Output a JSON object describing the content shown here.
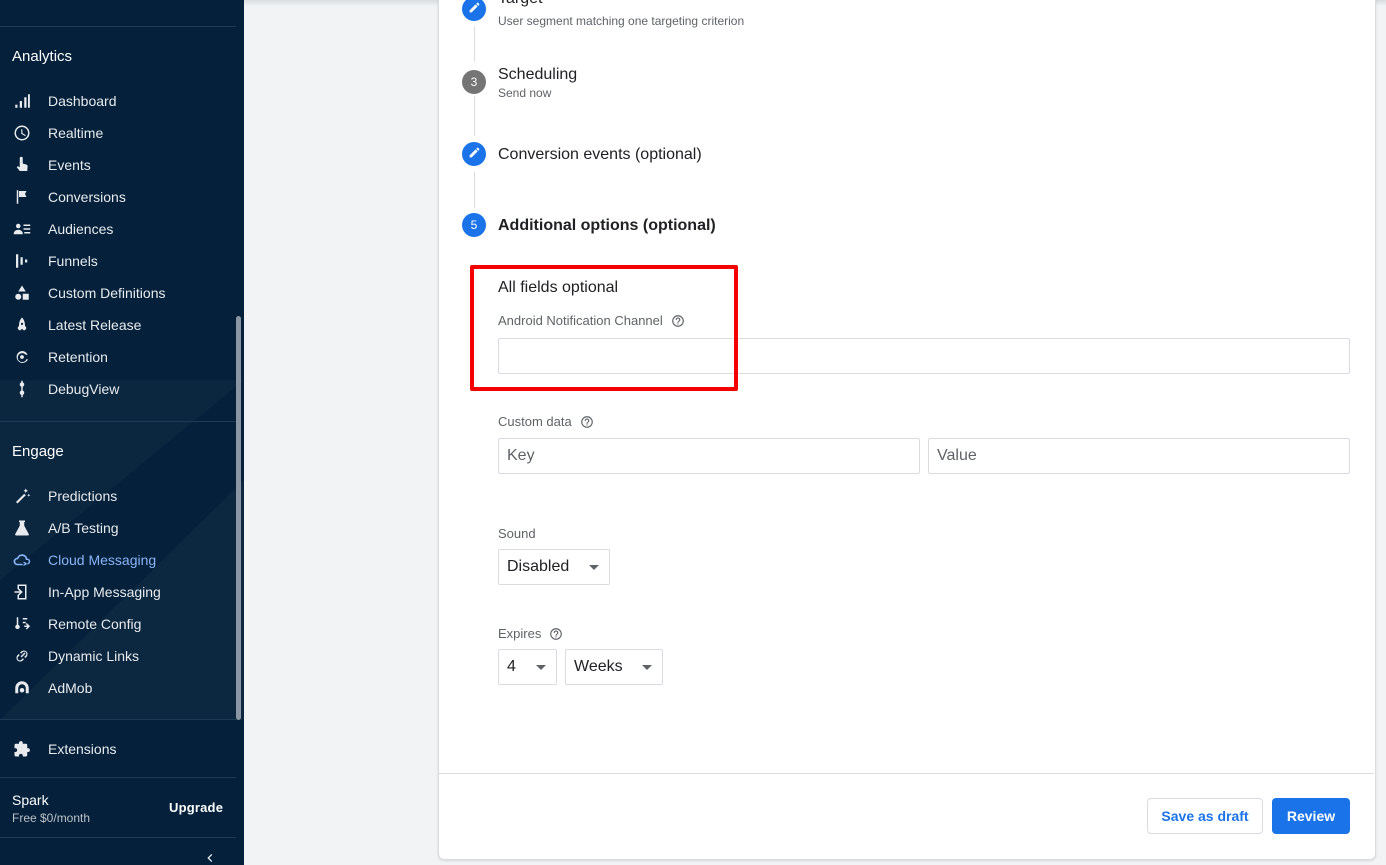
{
  "sidebar": {
    "analytics_title": "Analytics",
    "analytics_items": [
      {
        "label": "Dashboard",
        "icon": "bar-chart-icon"
      },
      {
        "label": "Realtime",
        "icon": "clock-icon"
      },
      {
        "label": "Events",
        "icon": "touch-icon"
      },
      {
        "label": "Conversions",
        "icon": "flag-icon"
      },
      {
        "label": "Audiences",
        "icon": "audience-icon"
      },
      {
        "label": "Funnels",
        "icon": "funnel-icon"
      },
      {
        "label": "Custom Definitions",
        "icon": "shapes-icon"
      },
      {
        "label": "Latest Release",
        "icon": "rocket-icon"
      },
      {
        "label": "Retention",
        "icon": "retention-icon"
      },
      {
        "label": "DebugView",
        "icon": "debug-icon"
      }
    ],
    "engage_title": "Engage",
    "engage_items": [
      {
        "label": "Predictions",
        "icon": "magic-wand-icon"
      },
      {
        "label": "A/B Testing",
        "icon": "flask-icon"
      },
      {
        "label": "Cloud Messaging",
        "icon": "cloud-messaging-icon",
        "active": true
      },
      {
        "label": "In-App Messaging",
        "icon": "in-app-messaging-icon"
      },
      {
        "label": "Remote Config",
        "icon": "remote-config-icon"
      },
      {
        "label": "Dynamic Links",
        "icon": "link-icon"
      },
      {
        "label": "AdMob",
        "icon": "admob-icon"
      }
    ],
    "extensions": {
      "label": "Extensions",
      "icon": "puzzle-icon"
    },
    "plan": {
      "name": "Spark",
      "price": "Free $0/month"
    },
    "upgrade_label": "Upgrade"
  },
  "steps": {
    "target": {
      "title": "Target",
      "subtitle": "User segment matching one targeting criterion"
    },
    "scheduling": {
      "number": "3",
      "title": "Scheduling",
      "subtitle": "Send now"
    },
    "conversion": {
      "title": "Conversion events (optional)"
    },
    "additional": {
      "number": "5",
      "title": "Additional options (optional)"
    }
  },
  "form": {
    "all_optional": "All fields optional",
    "android_channel_label": "Android Notification Channel",
    "android_channel_value": "",
    "custom_data_label": "Custom data",
    "key_placeholder": "Key",
    "value_placeholder": "Value",
    "sound_label": "Sound",
    "sound_value": "Disabled",
    "expires_label": "Expires",
    "expires_number": "4",
    "expires_unit": "Weeks"
  },
  "footer": {
    "save_draft_label": "Save as draft",
    "review_label": "Review"
  },
  "colors": {
    "sidebar_bg": "#04203a",
    "accent": "#1a73e8",
    "highlight": "#f40000",
    "active_nav": "#8ab4f8"
  }
}
